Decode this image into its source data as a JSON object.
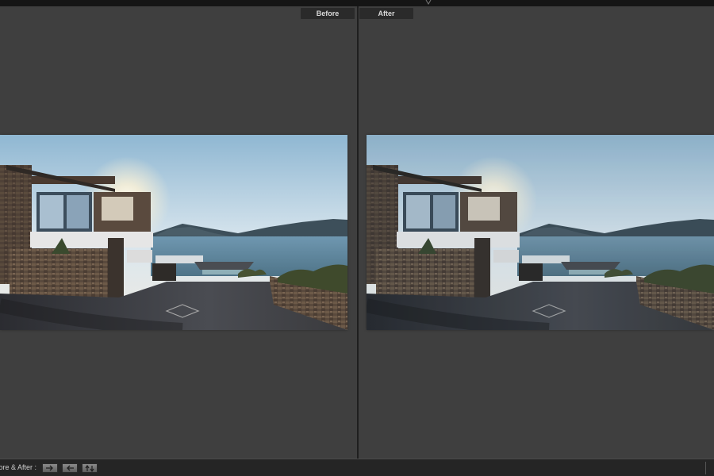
{
  "view": {
    "before_label": "Before",
    "after_label": "After"
  },
  "toolbar": {
    "before_after_label": "fore & After :",
    "buttons": [
      {
        "name": "copy-before-to-after",
        "icon": "arrow-right-icon"
      },
      {
        "name": "copy-after-to-before",
        "icon": "arrow-left-icon"
      },
      {
        "name": "swap-before-after",
        "icon": "swap-arrows-icon"
      }
    ]
  },
  "colors": {
    "background": "#3f3f3f",
    "chrome": "#151515",
    "label_bg": "#2a2a2a",
    "label_text": "#d9d9d9"
  },
  "photo": {
    "subject": "house-by-the-sea-photo"
  }
}
